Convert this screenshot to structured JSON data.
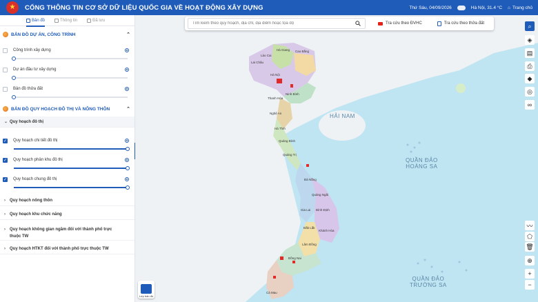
{
  "header": {
    "title": "CỔNG THÔNG TIN CƠ SỞ DỮ LIỆU QUỐC GIA VỀ HOẠT ĐỘNG XÂY DỰNG",
    "date": "Thứ Sáu, 04/09/2026",
    "weather": "Hà Nội, 31.4 °C",
    "home": "Trang chủ"
  },
  "tabs": [
    {
      "label": "Bản đồ",
      "active": true
    },
    {
      "label": "Thông tin",
      "active": false
    },
    {
      "label": "Đã lưu",
      "active": false
    }
  ],
  "section1": {
    "title": "BẢN ĐỒ DỰ ÁN, CÔNG TRÌNH",
    "layers": [
      {
        "label": "Công trình xây dựng",
        "checked": false,
        "opacity": 0
      },
      {
        "label": "Dự án đầu tư xây dựng",
        "checked": false,
        "opacity": 0
      },
      {
        "label": "Bản đồ thửa đất",
        "checked": false,
        "opacity": 0
      }
    ]
  },
  "section2": {
    "title": "BẢN ĐỒ QUY HOẠCH ĐÔ THỊ VÀ NÔNG THÔN",
    "group_open": "Quy hoạch đô thị",
    "layers": [
      {
        "label": "Quy hoạch chi tiết đô thị",
        "checked": true,
        "opacity": 1
      },
      {
        "label": "Quy hoạch phân khu đô thị",
        "checked": true,
        "opacity": 1
      },
      {
        "label": "Quy hoạch chung đô thị",
        "checked": true,
        "opacity": 1
      }
    ],
    "groups_closed": [
      "Quy hoạch nông thôn",
      "Quy hoạch khu chức năng",
      "Quy hoạch không gian ngầm đối với thành phố trực thuộc TW",
      "Quy hoạch HTKT đối với thành phố trực thuộc TW"
    ]
  },
  "search": {
    "placeholder": "Tìm kiếm theo quy hoạch, địa chỉ, địa điểm hoặc tọa độ",
    "lookup1": "Tra cứu theo ĐVHC",
    "lookup2": "Tra cứu theo thửa đất"
  },
  "map": {
    "labels": {
      "hainam": "HẢI NAM",
      "hoangsa": "QUẦN ĐẢO\nHOÀNG SA",
      "truongsa": "QUẦN ĐẢO\nTRƯỜNG SA"
    },
    "cities": [
      "Lai Châu",
      "Lào Cai",
      "Hà Giang",
      "Cao Bằng",
      "Hà Nội",
      "Ninh Bình",
      "Thanh Hóa",
      "Nghệ An",
      "Hà Tĩnh",
      "Quảng Bình",
      "Quảng Trị",
      "Đà Nẵng",
      "Quảng Ngãi",
      "Bình Định",
      "Gia Lai",
      "Đắk Lắk",
      "Lâm Đồng",
      "Khánh Hòa",
      "Đồng Nai",
      "Cà Mau"
    ],
    "basemap_label": "Lớp bản đồ"
  },
  "toolbar_icons": [
    "search-icon",
    "layers-icon",
    "book-icon",
    "print-icon",
    "direction-icon",
    "locate-icon",
    "link-icon",
    "polyline-icon",
    "polygon-icon",
    "trash-icon",
    "crosshair-icon",
    "zoom-in-icon",
    "zoom-out-icon"
  ],
  "colors": {
    "primary": "#1f5bb8",
    "sea": "#bfe4f2",
    "land": "#eef2f5"
  }
}
